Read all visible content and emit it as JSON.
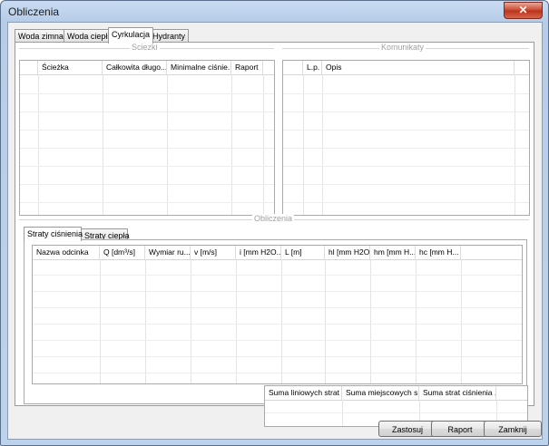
{
  "window": {
    "title": "Obliczenia",
    "close_glyph": "✕"
  },
  "tabs": [
    {
      "label": "Woda zimna"
    },
    {
      "label": "Woda ciepła"
    },
    {
      "label": "Cyrkulacja"
    },
    {
      "label": "Hydranty"
    }
  ],
  "groups": {
    "sciezki": "Sciezki",
    "komunikaty": "Komunikaty",
    "obliczenia": "Obliczenia"
  },
  "sciezki_grid": {
    "columns": [
      "Ścieżka",
      "Całkowita długo...",
      "Minimalne ciśnie...",
      "Raport"
    ]
  },
  "komunikaty_grid": {
    "columns": [
      "L.p.",
      "Opis"
    ]
  },
  "subtabs": [
    {
      "label": "Straty ciśnienia"
    },
    {
      "label": "Straty ciepła"
    }
  ],
  "straty_grid": {
    "columns": [
      "Nazwa odcinka",
      "Q [dm³/s]",
      "Wymiar ru...",
      "v [m/s]",
      "i [mm H2O...",
      "L [m]",
      "hl [mm H2O]",
      "hm [mm H...",
      "hc [mm H..."
    ]
  },
  "suma_grid": {
    "columns": [
      "Suma liniowych strat ...",
      "Suma miejscowych s...",
      "Suma strat ciśnienia ..."
    ]
  },
  "buttons": {
    "zastosuj": "Zastosuj",
    "raport": "Raport",
    "zamknij": "Zamknij"
  }
}
